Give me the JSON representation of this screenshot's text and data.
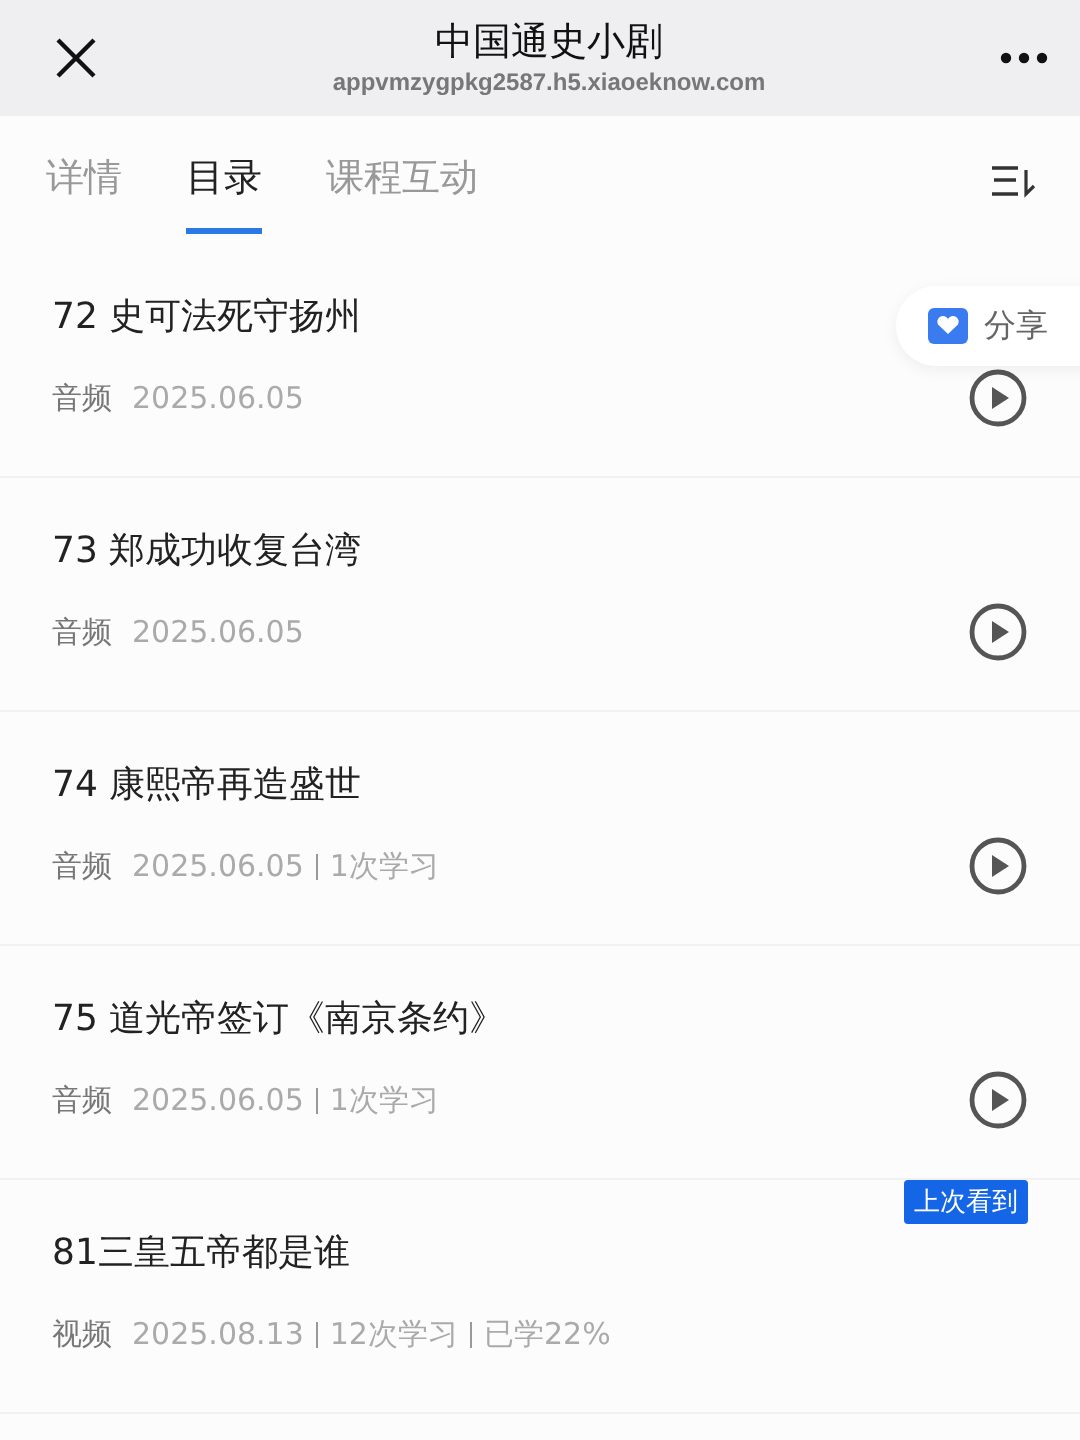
{
  "header": {
    "title": "中国通史小剧",
    "url": "appvmzygpkg2587.h5.xiaoeknow.com"
  },
  "tabs": [
    {
      "label": "详情",
      "selected": false
    },
    {
      "label": "目录",
      "selected": true
    },
    {
      "label": "课程互动",
      "selected": false
    }
  ],
  "share": {
    "label": "分享"
  },
  "items": [
    {
      "title": "72 史可法死守扬州",
      "type": "音频",
      "kind": "audio",
      "details": [
        "2025.06.05"
      ]
    },
    {
      "title": "73 郑成功收复台湾",
      "type": "音频",
      "kind": "audio",
      "details": [
        "2025.06.05"
      ]
    },
    {
      "title": "74 康熙帝再造盛世",
      "type": "音频",
      "kind": "audio",
      "details": [
        "2025.06.05",
        "1次学习"
      ]
    },
    {
      "title": "75 道光帝签订《南京条约》",
      "type": "音频",
      "kind": "audio",
      "details": [
        "2025.06.05",
        "1次学习"
      ]
    },
    {
      "title": "81三皇五帝都是谁",
      "type": "视频",
      "kind": "video",
      "badge": "上次看到",
      "details": [
        "2025.08.13",
        "12次学习",
        "已学22%"
      ]
    }
  ]
}
